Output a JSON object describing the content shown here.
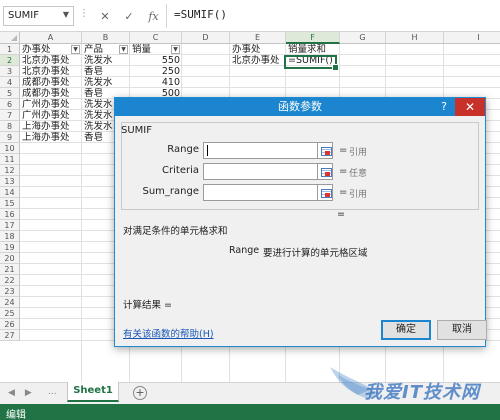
{
  "formula_bar": {
    "name_box": "SUMIF",
    "cancel_icon": "✕",
    "confirm_icon": "✓",
    "fx_label": "fx",
    "formula": "=SUMIF()"
  },
  "columns": [
    "A",
    "B",
    "C",
    "D",
    "E",
    "F",
    "G",
    "H",
    "I"
  ],
  "selected_column": "F",
  "rows": [
    "1",
    "2",
    "3",
    "4",
    "5",
    "6",
    "7",
    "8",
    "9",
    "10",
    "11",
    "12",
    "13",
    "14",
    "15",
    "16",
    "17",
    "18",
    "19",
    "20",
    "21",
    "22",
    "23",
    "24",
    "25",
    "26",
    "27"
  ],
  "selected_row": "2",
  "cells": {
    "A1": "办事处",
    "B1": "产品",
    "C1": "销量",
    "A2": "北京办事处",
    "B2": "洗发水",
    "C2": "550",
    "A3": "北京办事处",
    "B3": "香皂",
    "C3": "250",
    "A4": "成都办事处",
    "B4": "洗发水",
    "C4": "410",
    "A5": "成都办事处",
    "B5": "香皂",
    "C5": "500",
    "A6": "广州办事处",
    "B6": "洗发水",
    "A7": "广州办事处",
    "B7": "洗发水",
    "A8": "上海办事处",
    "B8": "洗发水",
    "A9": "上海办事处",
    "B9": "香皂",
    "E1": "办事处",
    "F1": "销量求和",
    "E2": "北京办事处",
    "F2": "=SUMIF()"
  },
  "dialog": {
    "title": "函数参数",
    "help_glyph": "?",
    "close_glyph": "✕",
    "function_name": "SUMIF",
    "args": [
      {
        "label": "Range",
        "value": "",
        "equals": "=",
        "hint": "引用"
      },
      {
        "label": "Criteria",
        "value": "",
        "equals": "=",
        "hint": "任意"
      },
      {
        "label": "Sum_range",
        "value": "",
        "equals": "=",
        "hint": "引用"
      }
    ],
    "result_equals": "=",
    "description": "对满足条件的单元格求和",
    "arg_description_name": "Range",
    "arg_description": "要进行计算的单元格区域",
    "result_label": "计算结果 =",
    "help_link": "有关该函数的帮助(H)",
    "ok": "确定",
    "cancel": "取消"
  },
  "sheet_tabs": {
    "dots": "...",
    "active": "Sheet1",
    "add": "+"
  },
  "status_bar": {
    "mode": "编辑"
  },
  "watermark": "我爱IT技术网",
  "colors": {
    "excel_green": "#217346",
    "dialog_blue": "#1b86cf",
    "close_red": "#c7312a"
  }
}
